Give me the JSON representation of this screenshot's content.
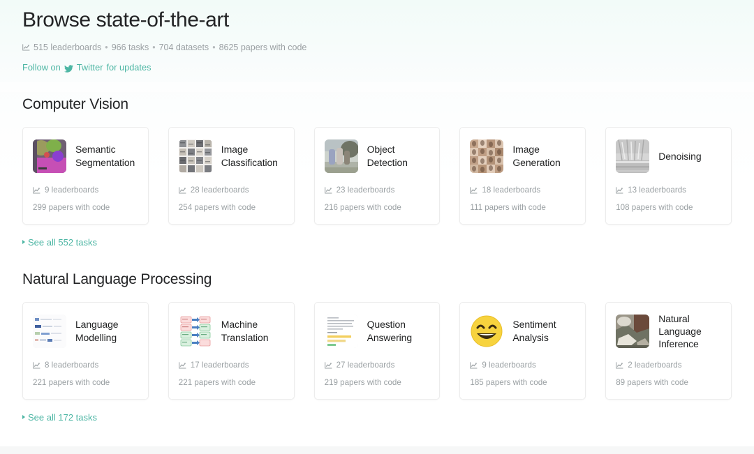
{
  "header": {
    "title": "Browse state-of-the-art",
    "stats": [
      "515 leaderboards",
      "966 tasks",
      "704 datasets",
      "8625 papers with code"
    ],
    "stats_separator": "•",
    "follow_prefix": "Follow on",
    "follow_link": "Twitter",
    "follow_suffix": "for updates",
    "accent_color": "#4db6a4",
    "muted_color": "#9aa0a3"
  },
  "sections": [
    {
      "title": "Computer Vision",
      "see_all": "See all 552 tasks",
      "cards": [
        {
          "title": "Semantic Segmentation",
          "leaderboards": "9 leaderboards",
          "papers": "299 papers with code",
          "thumb": "semantic-segmentation-thumbnail"
        },
        {
          "title": "Image Classification",
          "leaderboards": "28 leaderboards",
          "papers": "254 papers with code",
          "thumb": "image-classification-thumbnail"
        },
        {
          "title": "Object Detection",
          "leaderboards": "23 leaderboards",
          "papers": "216 papers with code",
          "thumb": "object-detection-thumbnail"
        },
        {
          "title": "Image Generation",
          "leaderboards": "18 leaderboards",
          "papers": "111 papers with code",
          "thumb": "image-generation-thumbnail"
        },
        {
          "title": "Denoising",
          "leaderboards": "13 leaderboards",
          "papers": "108 papers with code",
          "thumb": "denoising-thumbnail"
        }
      ]
    },
    {
      "title": "Natural Language Processing",
      "see_all": "See all 172 tasks",
      "cards": [
        {
          "title": "Language Modelling",
          "leaderboards": "8 leaderboards",
          "papers": "221 papers with code",
          "thumb": "language-modelling-thumbnail"
        },
        {
          "title": "Machine Translation",
          "leaderboards": "17 leaderboards",
          "papers": "221 papers with code",
          "thumb": "machine-translation-thumbnail"
        },
        {
          "title": "Question Answering",
          "leaderboards": "27 leaderboards",
          "papers": "219 papers with code",
          "thumb": "question-answering-thumbnail"
        },
        {
          "title": "Sentiment Analysis",
          "leaderboards": "9 leaderboards",
          "papers": "185 papers with code",
          "thumb": "sentiment-analysis-thumbnail"
        },
        {
          "title": "Natural Language Inference",
          "leaderboards": "2 leaderboards",
          "papers": "89 papers with code",
          "thumb": "natural-language-inference-thumbnail"
        }
      ]
    }
  ]
}
